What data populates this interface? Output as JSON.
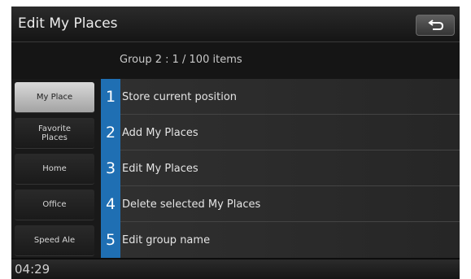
{
  "header": {
    "title": "Edit My Places",
    "back_icon": "back-arrow-icon"
  },
  "group_info": "Group 2 : 1 / 100 items",
  "sidebar": {
    "items": [
      {
        "label": "My Place",
        "active": true
      },
      {
        "label": "Favorite Places",
        "active": false
      },
      {
        "label": "Home",
        "active": false
      },
      {
        "label": "Office",
        "active": false
      },
      {
        "label": "Speed Ale",
        "active": false
      }
    ]
  },
  "menu": {
    "items": [
      {
        "number": "1",
        "label": "Store current position"
      },
      {
        "number": "2",
        "label": "Add My Places"
      },
      {
        "number": "3",
        "label": "Edit My Places"
      },
      {
        "number": "4",
        "label": "Delete selected My Places"
      },
      {
        "number": "5",
        "label": "Edit group name"
      }
    ]
  },
  "status": {
    "clock": "04:29"
  },
  "colors": {
    "accent": "#1f6fb3",
    "background": "#0d0d0d"
  }
}
